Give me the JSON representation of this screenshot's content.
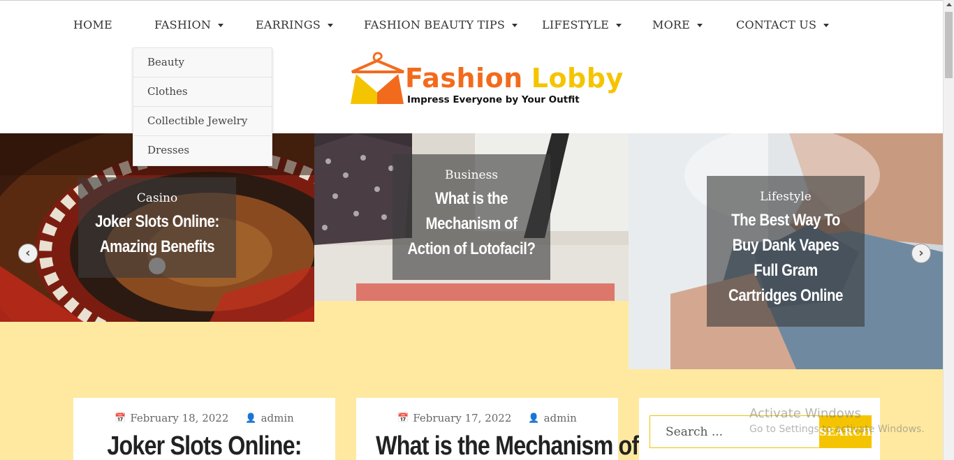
{
  "nav": {
    "items": [
      {
        "label": "HOME",
        "has_caret": false
      },
      {
        "label": "FASHION",
        "has_caret": true
      },
      {
        "label": "EARRINGS",
        "has_caret": true
      },
      {
        "label": "FASHION BEAUTY TIPS",
        "has_caret": true
      },
      {
        "label": "LIFESTYLE",
        "has_caret": true
      },
      {
        "label": "MORE",
        "has_caret": true
      },
      {
        "label": "CONTACT US",
        "has_caret": true
      }
    ],
    "dropdown": [
      "Beauty",
      "Clothes",
      "Collectible Jewelry",
      "Dresses"
    ]
  },
  "logo": {
    "name_part1": "Fashion",
    "name_part2": "Lobby",
    "tagline": "Impress Everyone by Your Outfit",
    "orange": "#f26b1d",
    "yellow": "#f5c400"
  },
  "slider": {
    "slides": [
      {
        "category": "Casino",
        "title": [
          "Joker Slots Online:",
          "Amazing Benefits"
        ]
      },
      {
        "category": "Business",
        "title": [
          "What is the",
          "Mechanism of",
          "Action of Lotofacil?"
        ]
      },
      {
        "category": "Lifestyle",
        "title": [
          "The Best Way To",
          "Buy Dank Vapes",
          "Full Gram",
          "Cartridges Online"
        ]
      }
    ],
    "prev_icon": "chevron-left-icon",
    "next_icon": "chevron-right-icon"
  },
  "posts": [
    {
      "date": "February 18, 2022",
      "author": "admin",
      "title": "Joker Slots Online:"
    },
    {
      "date": "February 17, 2022",
      "author": "admin",
      "title": "What is the Mechanism of"
    }
  ],
  "search": {
    "placeholder": "Search ...",
    "button_label": "Search"
  },
  "watermark": {
    "line1": "Activate Windows",
    "line2": "Go to Settings to activate Windows."
  },
  "colors": {
    "page_background": "#ffe9a0",
    "accent": "#f5c400"
  }
}
